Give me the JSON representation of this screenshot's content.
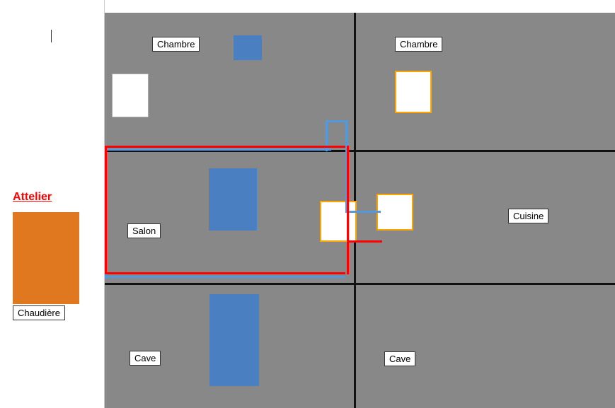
{
  "rooms": {
    "chambre_left": {
      "label": "Chambre"
    },
    "chambre_right": {
      "label": "Chambre"
    },
    "salon": {
      "label": "Salon"
    },
    "cuisine": {
      "label": "Cuisine"
    },
    "cave_left": {
      "label": "Cave"
    },
    "cave_right": {
      "label": "Cave"
    },
    "chaudiere": {
      "label": "Chaudière"
    },
    "attelier": {
      "label": "Attelier"
    }
  },
  "colors": {
    "gray_bg": "#888888",
    "blue_rect": "#4a7fc1",
    "orange_border": "#e08000",
    "orange_fill": "#e07820",
    "red_line": "#ff0000",
    "blue_pipe": "#5599dd",
    "black_line": "#111111",
    "white": "#ffffff"
  }
}
